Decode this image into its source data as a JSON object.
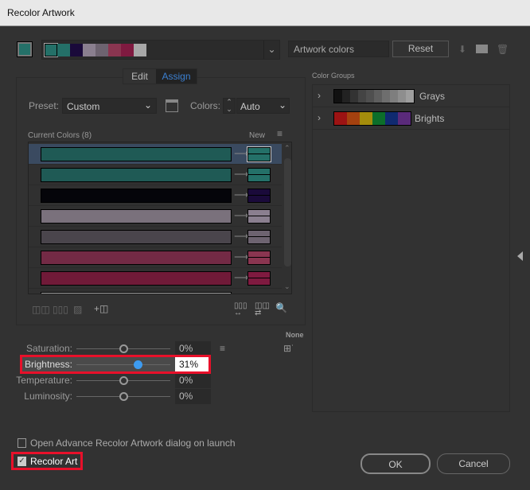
{
  "window": {
    "title": "Recolor Artwork"
  },
  "header": {
    "active_color": "#247068",
    "artwork_swatches": [
      "#247068",
      "#247068",
      "#1a0a3a",
      "#8a7f8f",
      "#6d6370",
      "#8a3550",
      "#7f1a40",
      "#a8a8a8"
    ],
    "artwork_field": "Artwork colors",
    "reset_label": "Reset"
  },
  "tabs": [
    {
      "label": "Edit",
      "active": false
    },
    {
      "label": "Assign",
      "active": true
    }
  ],
  "assign": {
    "preset_label": "Preset:",
    "preset_value": "Custom",
    "colors_label": "Colors:",
    "colors_value": "Auto",
    "current_colors_label": "Current Colors (8)",
    "new_label": "New",
    "rows": [
      {
        "current": "#1f5a55",
        "new": "#247068",
        "selected": true
      },
      {
        "current": "#1f5a55",
        "new": "#247068"
      },
      {
        "current": "#05050a",
        "new": "#1a0a3a"
      },
      {
        "current": "#7a717c",
        "new": "#8a7f8f"
      },
      {
        "current": "#4a454c",
        "new": "#6d6370"
      },
      {
        "current": "#732a45",
        "new": "#8a3550"
      },
      {
        "current": "#701a38",
        "new": "#7f1a40"
      },
      {
        "current": "#a8a8a8",
        "new": ""
      }
    ]
  },
  "adjust": {
    "none_label": "None",
    "sliders": [
      {
        "label": "Saturation:",
        "value": "0%",
        "level": 0
      },
      {
        "label": "Brightness:",
        "value": "31%",
        "level": 31,
        "active": true
      },
      {
        "label": "Temperature:",
        "value": "0%",
        "level": 0
      },
      {
        "label": "Luminosity:",
        "value": "0%",
        "level": 0
      }
    ]
  },
  "color_groups": {
    "label": "Color Groups",
    "groups": [
      {
        "name": "Grays",
        "swatches": [
          "#111",
          "#222",
          "#333",
          "#444",
          "#4f4f4f",
          "#5e5e5e",
          "#6e6e6e",
          "#7e7e7e",
          "#8e8e8e",
          "#9e9e9e"
        ]
      },
      {
        "name": "Brights",
        "swatches": [
          "#9c1313",
          "#a4410f",
          "#a48c0c",
          "#0c6e2a",
          "#102a70",
          "#5a2a7a"
        ]
      }
    ]
  },
  "footer": {
    "open_advance_label": "Open Advance Recolor Artwork dialog on launch",
    "open_advance_checked": false,
    "recolor_art_label": "Recolor Art",
    "recolor_art_checked": true,
    "ok_label": "OK",
    "cancel_label": "Cancel"
  },
  "highlight_color": "#e8102a"
}
